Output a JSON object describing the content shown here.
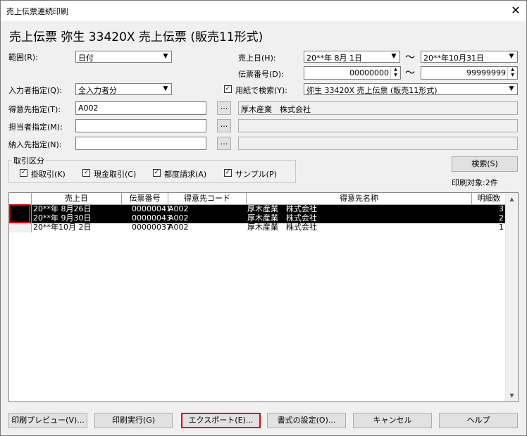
{
  "window": {
    "title": "売上伝票連続印刷",
    "close_glyph": "✕"
  },
  "heading": "売上伝票 弥生 33420X 売上伝票 (販売11形式)",
  "filters": {
    "range_label": "範囲(R):",
    "range_value": "日付",
    "sales_date_label": "売上日(H):",
    "date_from": "20**年 8月 1日",
    "date_to": "20**年10月31日",
    "tilde": "～",
    "slip_no_label": "伝票番号(D):",
    "slip_from": "00000000",
    "slip_to": "99999999",
    "entry_person_label": "入力者指定(Q):",
    "entry_person_value": "全入力者分",
    "paper_search_label": "用紙で検索(Y):",
    "paper_value": "弥生 33420X 売上伝票 (販売11形式)",
    "customer_label": "得意先指定(T):",
    "customer_code": "A002",
    "customer_name": "厚木産業　株式会社",
    "staff_label": "担当者指定(M):",
    "staff_code": "",
    "staff_name": "",
    "delivery_label": "納入先指定(N):",
    "delivery_code": "",
    "delivery_name": "",
    "dots": "..."
  },
  "transaction_group": {
    "title": "取引区分",
    "items": [
      "掛取引(K)",
      "現金取引(C)",
      "都度請求(A)",
      "サンプル(P)"
    ]
  },
  "search_button": "検索(S)",
  "print_target": "印刷対象:2件",
  "table": {
    "columns": [
      "売上日",
      "伝票番号",
      "得意先コード",
      "得意先名称",
      "明細数"
    ],
    "rows": [
      {
        "date": "20**年 8月26日",
        "slip": "00000041",
        "code": "A002",
        "name": "厚木産業　株式会社",
        "count": "3"
      },
      {
        "date": "20**年 9月30日",
        "slip": "00000043",
        "code": "A002",
        "name": "厚木産業　株式会社",
        "count": "2"
      },
      {
        "date": "20**年10月 2日",
        "slip": "00000037",
        "code": "A002",
        "name": "厚木産業　株式会社",
        "count": "1"
      }
    ]
  },
  "buttons": {
    "preview": "印刷プレビュー(V)...",
    "print": "印刷実行(G)",
    "export": "エクスポート(E)...",
    "format": "書式の設定(O)...",
    "cancel": "キャンセル",
    "help": "ヘルプ"
  }
}
